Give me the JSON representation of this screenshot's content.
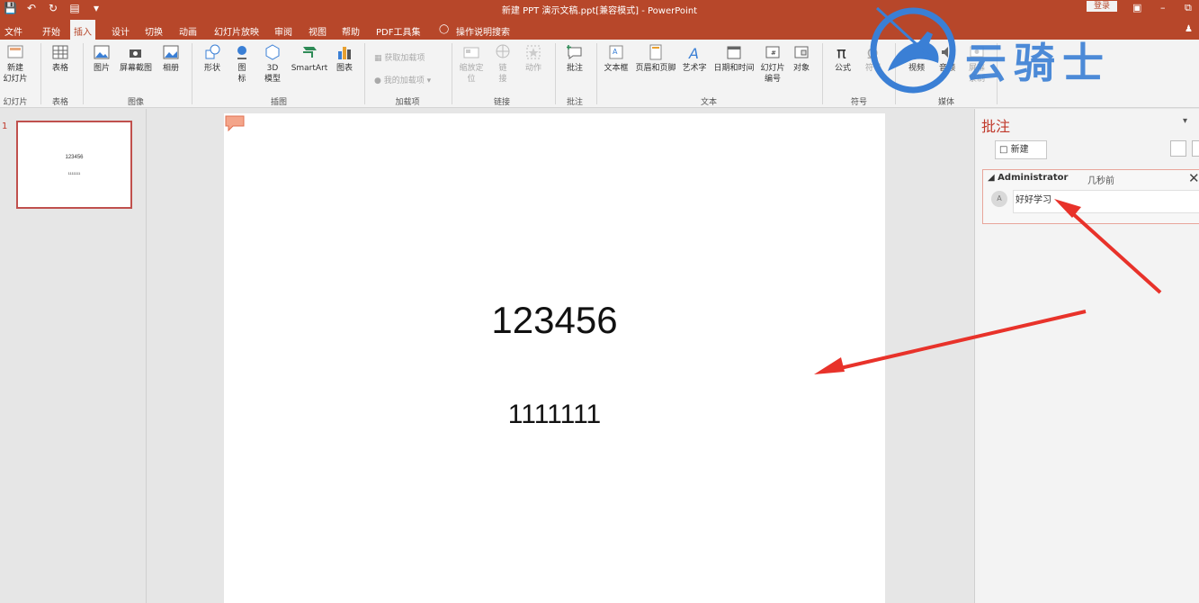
{
  "window": {
    "title": "新建 PPT 演示文稿.ppt[兼容模式] - PowerPoint",
    "login": "登录"
  },
  "tabs": [
    {
      "label": "文件"
    },
    {
      "label": "开始"
    },
    {
      "label": "插入",
      "active": true
    },
    {
      "label": "设计"
    },
    {
      "label": "切换"
    },
    {
      "label": "动画"
    },
    {
      "label": "幻灯片放映"
    },
    {
      "label": "审阅"
    },
    {
      "label": "视图"
    },
    {
      "label": "帮助"
    },
    {
      "label": "PDF工具集"
    },
    {
      "label": "操作说明搜索"
    }
  ],
  "ribbon": {
    "new_slide": "新建\n幻灯片",
    "table": "表格",
    "picture": "图片",
    "screenshot": "屏幕截图",
    "album": "相册",
    "shapes": "形状",
    "icons": "图\n标",
    "model3d": "3D\n模型",
    "smartart": "SmartArt",
    "chart": "图表",
    "get_addins": "获取加载项",
    "my_addins": "我的加载项",
    "zoom": "缩放定\n位",
    "link": "链\n接",
    "action": "动作",
    "comment": "批注",
    "textbox": "文本框",
    "header_footer": "页眉和页脚",
    "wordart": "艺术字",
    "datetime": "日期和时间",
    "slide_number": "幻灯片\n编号",
    "object": "对象",
    "equation": "公式",
    "symbol": "符号",
    "video": "视频",
    "audio": "音频",
    "screen_record": "屏幕\n录制",
    "groups": {
      "slides": "幻灯片",
      "tables": "表格",
      "images": "图像",
      "illustrations": "插图",
      "addins": "加载项",
      "links": "链接",
      "comments": "批注",
      "text": "文本",
      "symbols": "符号",
      "media": "媒体"
    }
  },
  "thumbnails": [
    {
      "number": "1",
      "title": "123456",
      "subtitle": "1111111"
    }
  ],
  "slide": {
    "title": "123456",
    "subtitle": "1111111"
  },
  "comments_pane": {
    "title": "批注",
    "new_button": "新建",
    "comment": {
      "author": "Administrator",
      "time": "几秒前",
      "avatar_initial": "A",
      "text": "好好学习"
    }
  },
  "watermark": {
    "text": "云骑士"
  },
  "colors": {
    "accent": "#b7472a",
    "arrow": "#e8322a",
    "watermark": "#3a7fd5"
  }
}
